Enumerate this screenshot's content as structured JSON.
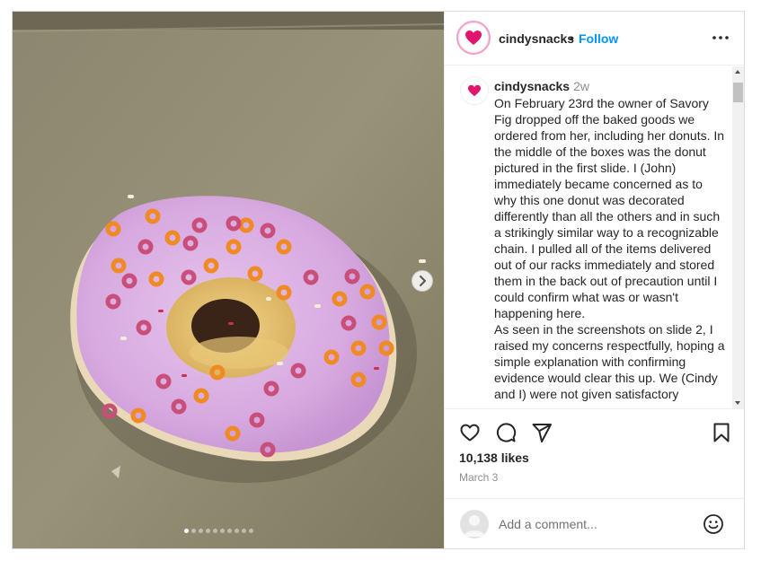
{
  "post": {
    "username": "cindysnacks",
    "follow_label": "Follow",
    "separator": "•",
    "more_icon": "more-horizontal-icon",
    "image": {
      "subject": "pink frosted donut with sprinkles",
      "slide_count": 10,
      "active_slide": 1,
      "next_icon": "chevron-right-icon"
    },
    "caption": {
      "username": "cindysnacks",
      "time": "2w",
      "text": "On February 23rd the owner of Savory Fig dropped off the baked goods we ordered from her, including her donuts. In the middle of the boxes was the donut pictured in the first slide. I (John) immediately became concerned as to why this one donut was decorated differently than all the others and in such a strikingly similar way to a recognizable chain. I pulled all of the items delivered out of our racks immediately and stored them in the back out of precaution until I could confirm what was or wasn't happening here.\nAs seen in the screenshots on slide 2, I raised my concerns respectfully, hoping a simple explanation with confirming evidence would clear this up. We (Cindy and I) were not given satisfactory"
    },
    "actions": {
      "like_icon": "heart-icon",
      "comment_icon": "comment-icon",
      "share_icon": "share-icon",
      "save_icon": "bookmark-icon"
    },
    "likes": "10,138 likes",
    "date": "March 3",
    "comment": {
      "placeholder": "Add a comment...",
      "emoji_icon": "emoji-icon"
    }
  },
  "colors": {
    "accent": "#0095f6",
    "brand_heart": "#e0156d",
    "text": "#262626",
    "muted": "#8e8e8e"
  }
}
